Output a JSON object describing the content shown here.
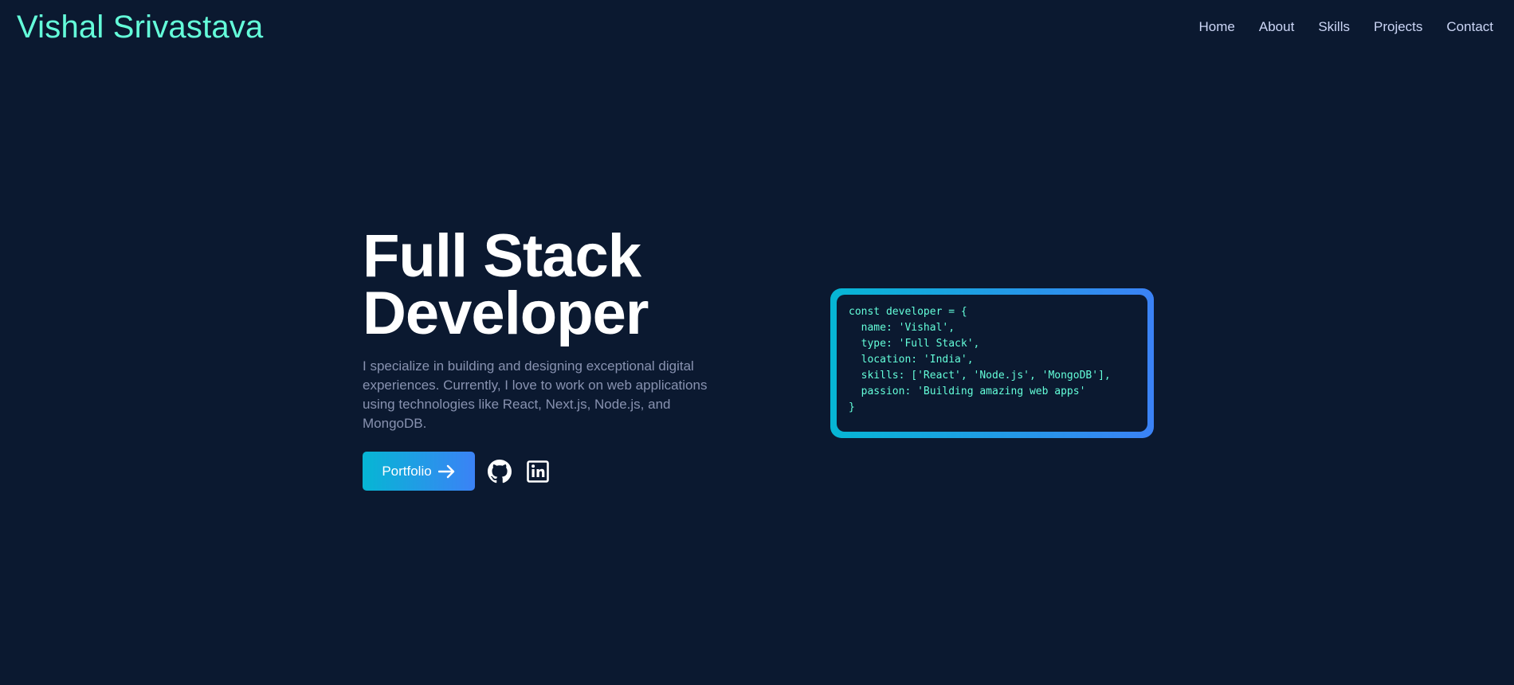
{
  "header": {
    "brand": "Vishal Srivastava",
    "nav": [
      "Home",
      "About",
      "Skills",
      "Projects",
      "Contact"
    ]
  },
  "hero": {
    "title_line1": "Full Stack",
    "title_line2": "Developer",
    "description": "I specialize in building and designing exceptional digital experiences. Currently, I love to work on web applications using technologies like React, Next.js, Node.js, and MongoDB.",
    "portfolio_label": "Portfolio",
    "icons": [
      "arrow-right-icon",
      "github-icon",
      "linkedin-icon"
    ]
  },
  "code": {
    "lines": [
      "const developer = {",
      "  name: 'Vishal',",
      "  type: 'Full Stack',",
      "  location: 'India',",
      "  skills: ['React', 'Node.js', 'MongoDB'],",
      "  passion: 'Building amazing web apps'",
      "}"
    ]
  },
  "colors": {
    "background": "#0b1930",
    "accent": "#64ffda",
    "gradient_start": "#06b6d4",
    "gradient_end": "#3b82f6"
  }
}
